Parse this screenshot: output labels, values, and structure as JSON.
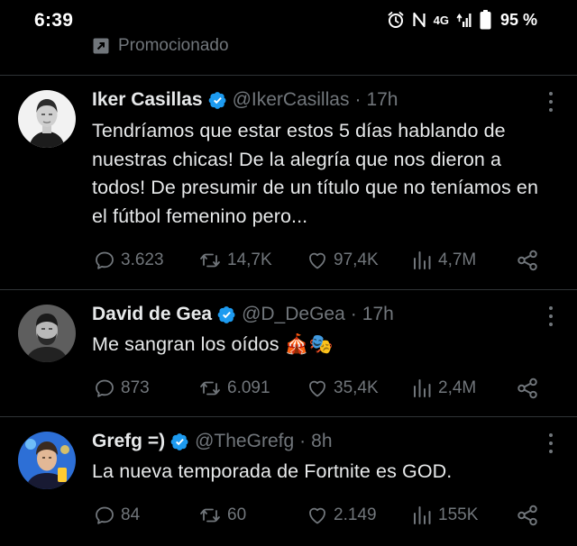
{
  "status_bar": {
    "time": "6:39",
    "network": "4G",
    "battery": "95 %"
  },
  "promoted": {
    "label": "Promocionado"
  },
  "tweets": [
    {
      "name": "Iker Casillas",
      "handle": "@IkerCasillas",
      "time": "17h",
      "text": "Tendríamos que estar estos 5 días hablando de nuestras chicas! De la alegría que nos dieron a todos! De presumir de un título que no teníamos en el fútbol femenino pero...",
      "replies": "3.623",
      "retweets": "14,7K",
      "likes": "97,4K",
      "views": "4,7M"
    },
    {
      "name": "David de Gea",
      "handle": "@D_DeGea",
      "time": "17h",
      "text": "Me sangran los oídos 🎪🎭",
      "replies": "873",
      "retweets": "6.091",
      "likes": "35,4K",
      "views": "2,4M"
    },
    {
      "name": "Grefg =)",
      "handle": "@TheGrefg",
      "time": "8h",
      "text": "La nueva temporada de Fortnite es GOD.",
      "replies": "84",
      "retweets": "60",
      "likes": "2.149",
      "views": "155K"
    }
  ],
  "colors": {
    "background": "#000000",
    "text": "#e7e9ea",
    "muted": "#71767b",
    "verified": "#1d9bf0",
    "divider": "#2f3336"
  },
  "icons": [
    "alarm-icon",
    "nfc-icon",
    "signal-icon",
    "battery-icon",
    "promoted-icon",
    "verified-icon",
    "more-icon",
    "reply-icon",
    "retweet-icon",
    "like-icon",
    "views-icon",
    "share-icon"
  ]
}
